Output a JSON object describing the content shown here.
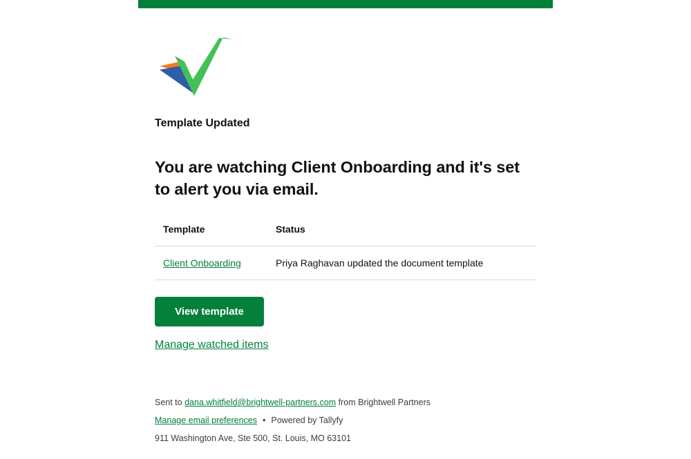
{
  "brand": {
    "accent_color": "#008038",
    "logo_icon": "checkmark-logo-icon"
  },
  "email": {
    "eyebrow": "Template Updated",
    "headline": "You are watching Client Onboarding and it's set to alert you via email.",
    "table": {
      "headers": [
        "Template",
        "Status"
      ],
      "rows": [
        {
          "template": "Client Onboarding",
          "status": "Priya Raghavan updated the document template"
        }
      ]
    },
    "cta_label": "View template",
    "manage_watched_label": "Manage watched items"
  },
  "footer": {
    "sent_to_prefix": "Sent to",
    "recipient_email": "dana.whitfield@brightwell-partners.com",
    "from_text": "from Brightwell Partners",
    "manage_prefs_label": "Manage email preferences",
    "separator": "•",
    "powered_by": "Powered by Tallyfy",
    "address": "911 Washington Ave, Ste 500, St. Louis, MO 63101"
  }
}
